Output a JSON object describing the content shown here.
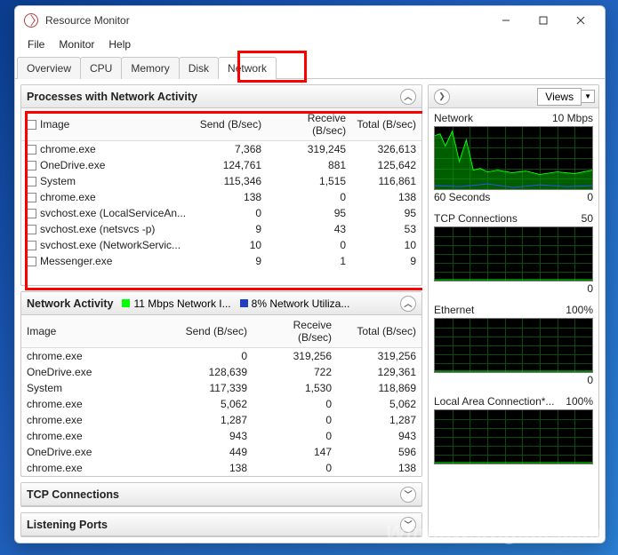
{
  "window": {
    "title": "Resource Monitor"
  },
  "menu": {
    "file": "File",
    "monitor": "Monitor",
    "help": "Help"
  },
  "tabs": {
    "overview": "Overview",
    "cpu": "CPU",
    "memory": "Memory",
    "disk": "Disk",
    "network": "Network"
  },
  "panel1": {
    "title": "Processes with Network Activity",
    "cols": {
      "image": "Image",
      "send": "Send (B/sec)",
      "recv": "Receive (B/sec)",
      "total": "Total (B/sec)"
    },
    "rows": [
      {
        "image": "chrome.exe",
        "send": "7,368",
        "recv": "319,245",
        "total": "326,613"
      },
      {
        "image": "OneDrive.exe",
        "send": "124,761",
        "recv": "881",
        "total": "125,642"
      },
      {
        "image": "System",
        "send": "115,346",
        "recv": "1,515",
        "total": "116,861"
      },
      {
        "image": "chrome.exe",
        "send": "138",
        "recv": "0",
        "total": "138"
      },
      {
        "image": "svchost.exe (LocalServiceAn...",
        "send": "0",
        "recv": "95",
        "total": "95"
      },
      {
        "image": "svchost.exe (netsvcs -p)",
        "send": "9",
        "recv": "43",
        "total": "53"
      },
      {
        "image": "svchost.exe (NetworkServic...",
        "send": "10",
        "recv": "0",
        "total": "10"
      },
      {
        "image": "Messenger.exe",
        "send": "9",
        "recv": "1",
        "total": "9"
      }
    ]
  },
  "panel2": {
    "title": "Network Activity",
    "legend1": "11 Mbps Network I...",
    "legend2": "8% Network Utiliza...",
    "cols": {
      "image": "Image",
      "send": "Send (B/sec)",
      "recv": "Receive (B/sec)",
      "total": "Total (B/sec)"
    },
    "rows": [
      {
        "image": "chrome.exe",
        "send": "0",
        "recv": "319,256",
        "total": "319,256"
      },
      {
        "image": "OneDrive.exe",
        "send": "128,639",
        "recv": "722",
        "total": "129,361"
      },
      {
        "image": "System",
        "send": "117,339",
        "recv": "1,530",
        "total": "118,869"
      },
      {
        "image": "chrome.exe",
        "send": "5,062",
        "recv": "0",
        "total": "5,062"
      },
      {
        "image": "chrome.exe",
        "send": "1,287",
        "recv": "0",
        "total": "1,287"
      },
      {
        "image": "chrome.exe",
        "send": "943",
        "recv": "0",
        "total": "943"
      },
      {
        "image": "OneDrive.exe",
        "send": "449",
        "recv": "147",
        "total": "596"
      },
      {
        "image": "chrome.exe",
        "send": "138",
        "recv": "0",
        "total": "138"
      }
    ]
  },
  "panel3": {
    "title": "TCP Connections"
  },
  "panel4": {
    "title": "Listening Ports"
  },
  "sidebar": {
    "views": "Views",
    "charts": [
      {
        "title": "Network",
        "rvalue": "10 Mbps",
        "sub_l": "60 Seconds",
        "sub_r": "0",
        "type": "wave"
      },
      {
        "title": "TCP Connections",
        "rvalue": "50",
        "sub_l": "",
        "sub_r": "0",
        "type": "flat"
      },
      {
        "title": "Ethernet",
        "rvalue": "100%",
        "sub_l": "",
        "sub_r": "0",
        "type": "flat"
      },
      {
        "title": "Local Area Connection*...",
        "rvalue": "100%",
        "sub_l": "",
        "sub_r": "",
        "type": "flat"
      }
    ]
  }
}
